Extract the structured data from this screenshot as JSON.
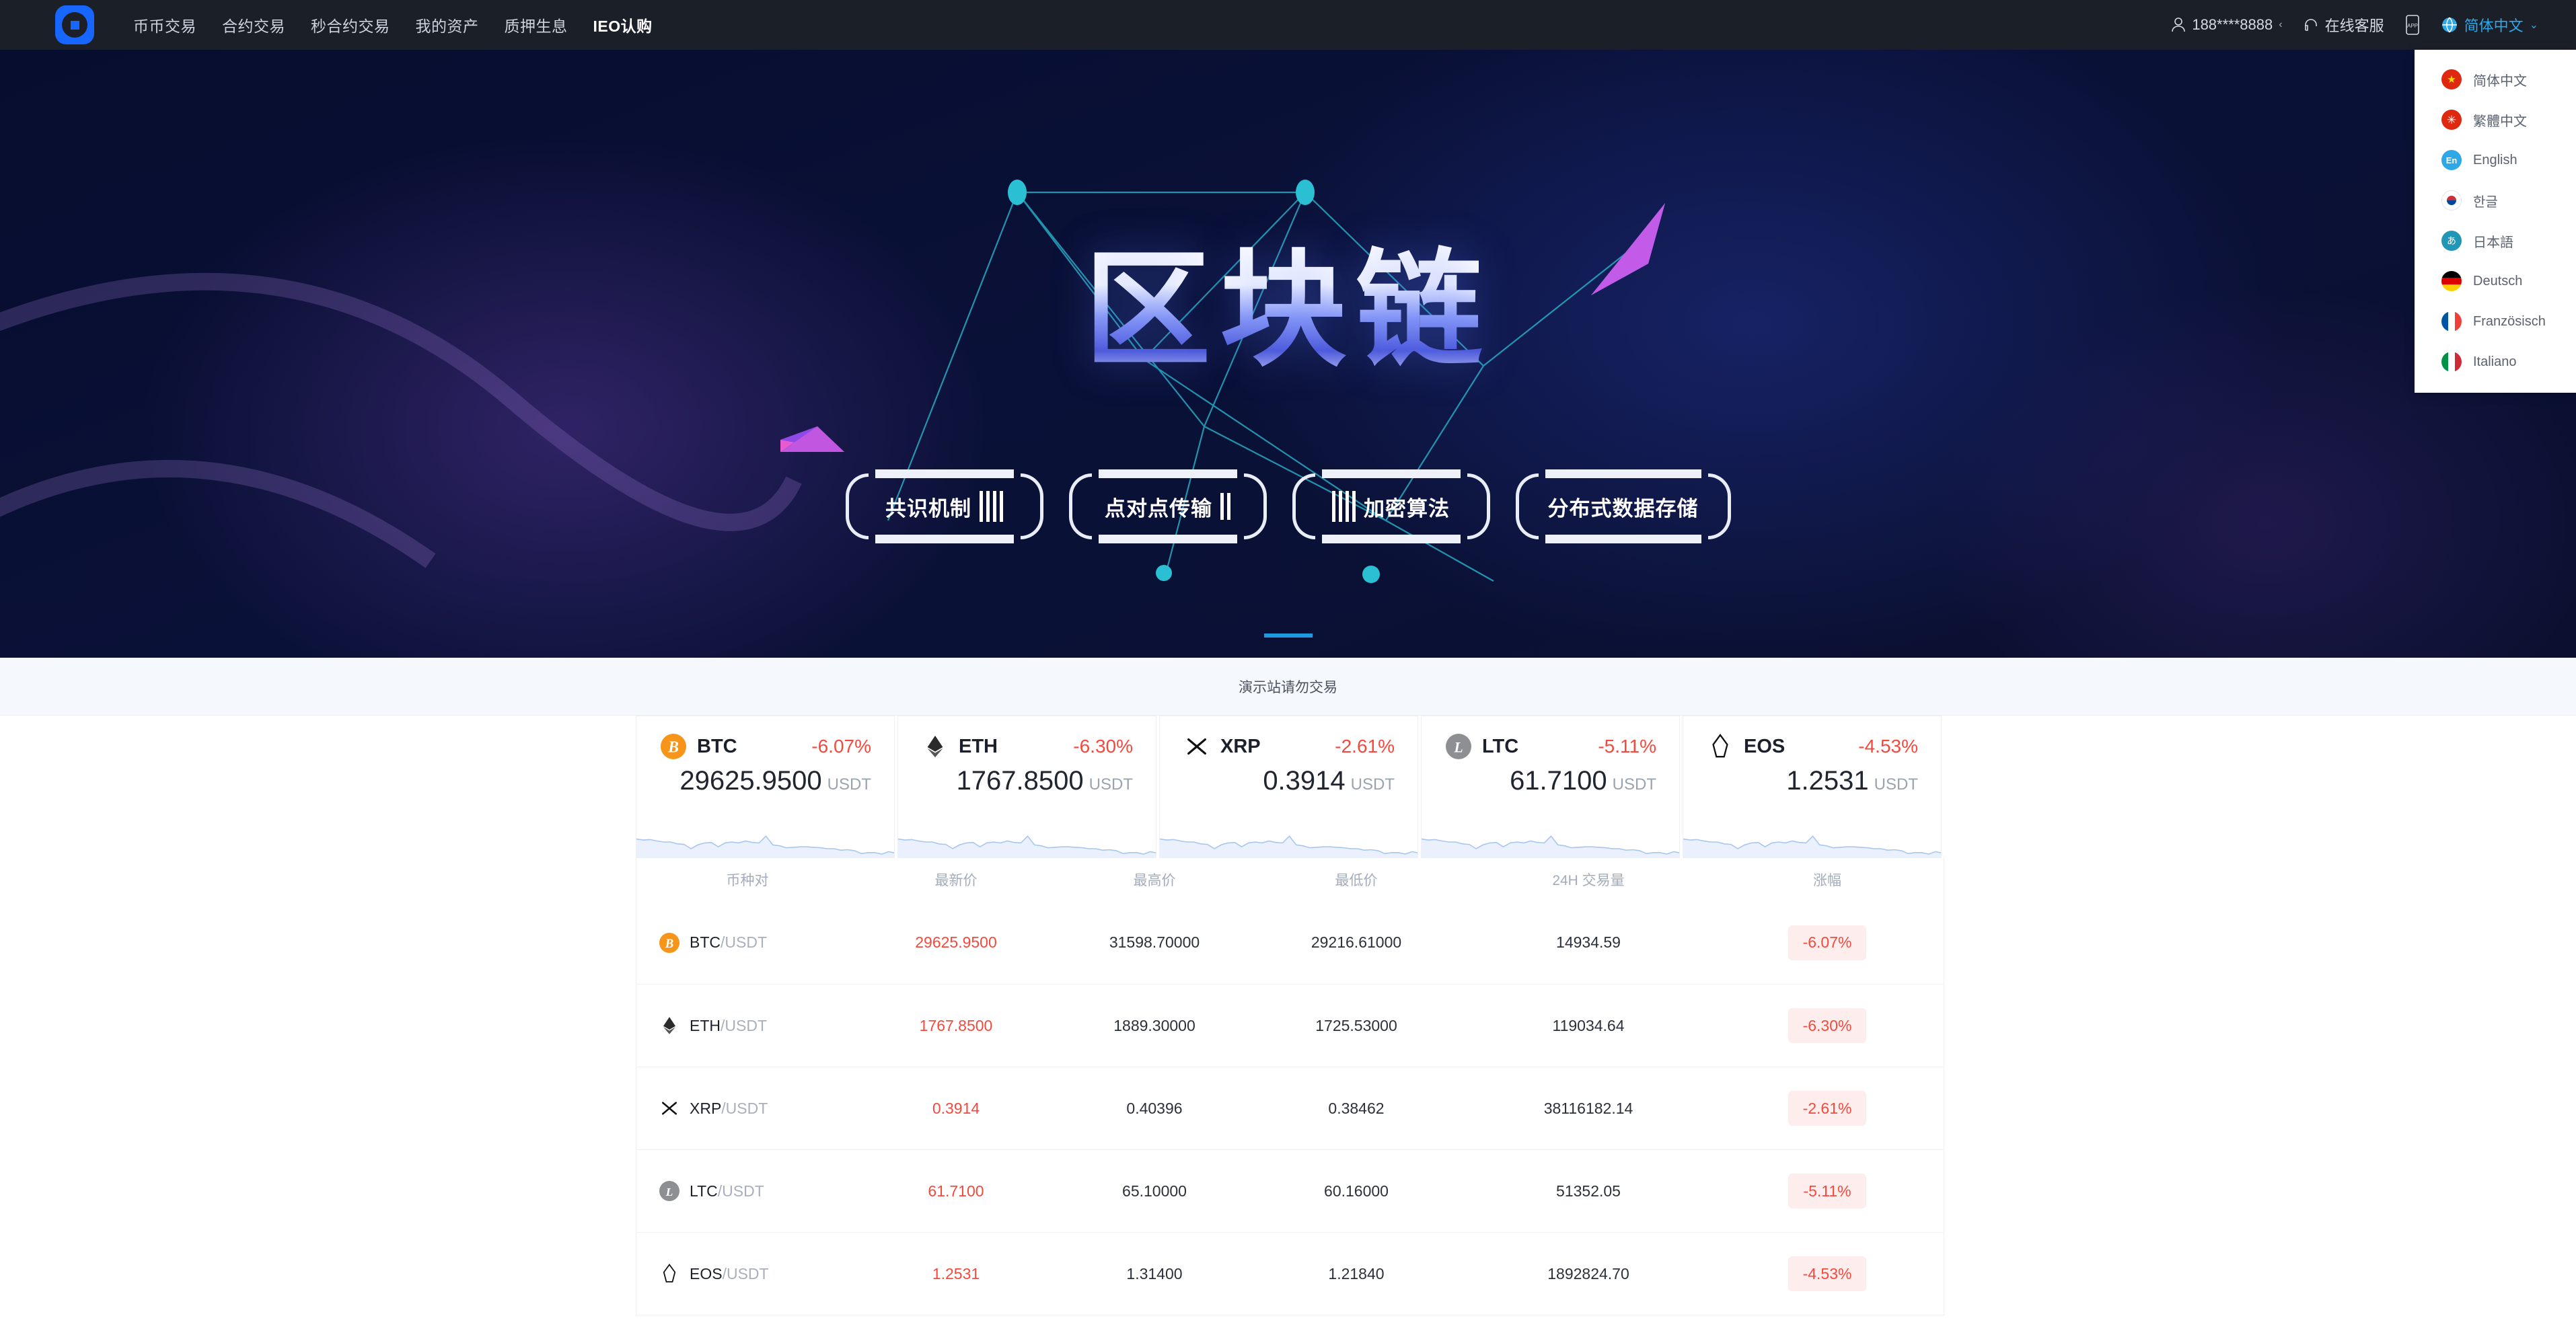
{
  "header": {
    "logo_name": "brand-logo",
    "nav": [
      {
        "label": "币币交易",
        "active": false
      },
      {
        "label": "合约交易",
        "active": false
      },
      {
        "label": "秒合约交易",
        "active": false
      },
      {
        "label": "我的资产",
        "active": false
      },
      {
        "label": "质押生息",
        "active": false
      },
      {
        "label": "IEO认购",
        "active": true
      }
    ],
    "account": "188****8888",
    "account_chevron": "‹",
    "support": "在线客服",
    "app_label": "APP",
    "language": "简体中文",
    "lang_chevron": "⌄"
  },
  "language_menu": {
    "items": [
      {
        "label": "简体中文",
        "flag": "cn",
        "glyph": "★"
      },
      {
        "label": "繁體中文",
        "flag": "hk",
        "glyph": "✳"
      },
      {
        "label": "English",
        "flag": "en",
        "glyph": "En"
      },
      {
        "label": "한글",
        "flag": "kr",
        "glyph": ""
      },
      {
        "label": "日本語",
        "flag": "jp",
        "glyph": "あ"
      },
      {
        "label": "Deutsch",
        "flag": "de",
        "glyph": ""
      },
      {
        "label": "Französisch",
        "flag": "fr",
        "glyph": ""
      },
      {
        "label": "Italiano",
        "flag": "it",
        "glyph": ""
      }
    ]
  },
  "banner": {
    "title": "区块链",
    "pills": [
      "共识机制",
      "点对点传输",
      "加密算法",
      "分布式数据存储"
    ],
    "accent_color": "#1e9ae0"
  },
  "notice": {
    "text": "演示站请勿交易"
  },
  "tickers": [
    {
      "symbol": "BTC",
      "change": "-6.07%",
      "price": "29625.9500",
      "unit": "USDT",
      "icon": "bitcoin-icon"
    },
    {
      "symbol": "ETH",
      "change": "-6.30%",
      "price": "1767.8500",
      "unit": "USDT",
      "icon": "ethereum-icon"
    },
    {
      "symbol": "XRP",
      "change": "-2.61%",
      "price": "0.3914",
      "unit": "USDT",
      "icon": "ripple-icon"
    },
    {
      "symbol": "LTC",
      "change": "-5.11%",
      "price": "61.7100",
      "unit": "USDT",
      "icon": "litecoin-icon"
    },
    {
      "symbol": "EOS",
      "change": "-4.53%",
      "price": "1.2531",
      "unit": "USDT",
      "icon": "eos-icon"
    }
  ],
  "market_table": {
    "columns": [
      "币种对",
      "最新价",
      "最高价",
      "最低价",
      "24H 交易量",
      "涨幅"
    ],
    "rows": [
      {
        "base": "BTC",
        "quote": "/USDT",
        "last": "29625.9500",
        "high": "31598.70000",
        "low": "29216.61000",
        "volume": "14934.59",
        "change": "-6.07%",
        "icon": "bitcoin-icon"
      },
      {
        "base": "ETH",
        "quote": "/USDT",
        "last": "1767.8500",
        "high": "1889.30000",
        "low": "1725.53000",
        "volume": "119034.64",
        "change": "-6.30%",
        "icon": "ethereum-icon"
      },
      {
        "base": "XRP",
        "quote": "/USDT",
        "last": "0.3914",
        "high": "0.40396",
        "low": "0.38462",
        "volume": "38116182.14",
        "change": "-2.61%",
        "icon": "ripple-icon"
      },
      {
        "base": "LTC",
        "quote": "/USDT",
        "last": "61.7100",
        "high": "65.10000",
        "low": "60.16000",
        "volume": "51352.05",
        "change": "-5.11%",
        "icon": "litecoin-icon"
      },
      {
        "base": "EOS",
        "quote": "/USDT",
        "last": "1.2531",
        "high": "1.31400",
        "low": "1.21840",
        "volume": "1892824.70",
        "change": "-4.53%",
        "icon": "eos-icon"
      }
    ]
  },
  "colors": {
    "down_red": "#f4493d",
    "brand_blue": "#1766ff",
    "link_blue": "#2fa8e8",
    "header_bg": "#1b1f27"
  }
}
